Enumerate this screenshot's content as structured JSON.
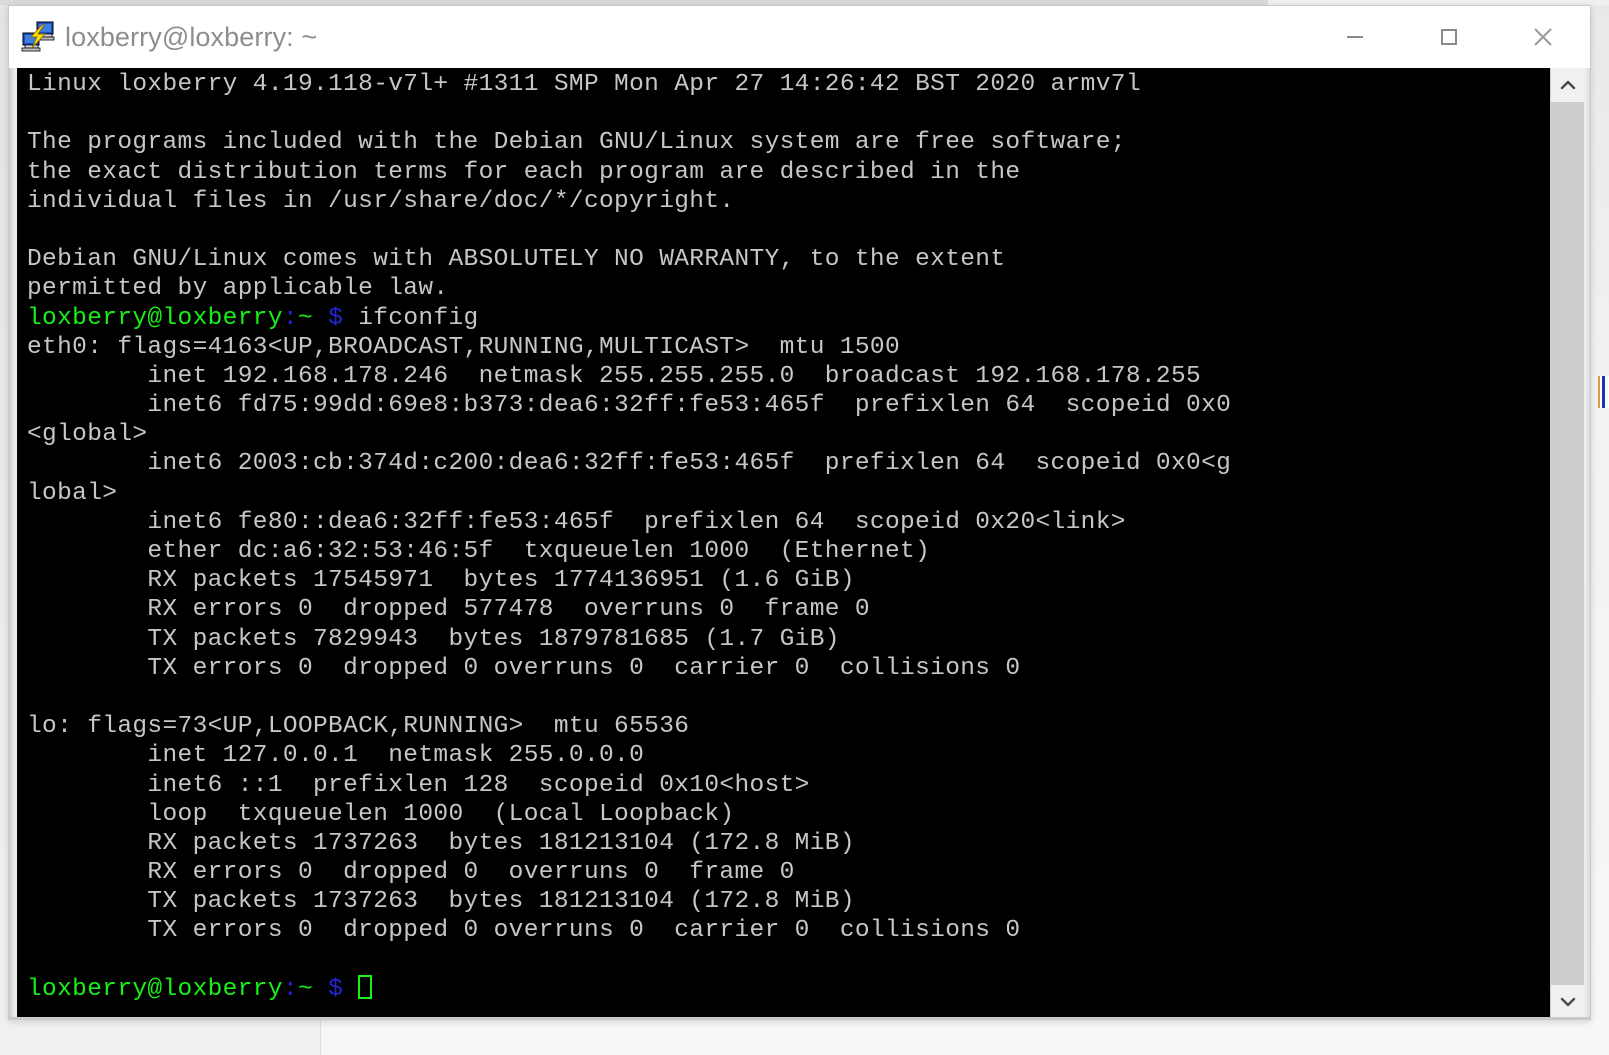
{
  "window": {
    "title": "loxberry@loxberry: ~",
    "icon": "putty-computers-icon",
    "controls": {
      "minimize": "—",
      "maximize": "□",
      "close": "✕"
    }
  },
  "scrollbar": {
    "up_arrow": "∧",
    "down_arrow": "∨"
  },
  "terminal": {
    "colors": {
      "background": "#000000",
      "foreground": "#bfbfbf",
      "prompt_user": "#18f018",
      "prompt_symbol": "#2424d6",
      "cursor": "#18f018"
    },
    "prompt": {
      "user_host": "loxberry@loxberry",
      "separator": ":",
      "path": "~",
      "dollar": "$"
    },
    "command": "ifconfig",
    "lines": [
      "Linux loxberry 4.19.118-v7l+ #1311 SMP Mon Apr 27 14:26:42 BST 2020 armv7l",
      "",
      "The programs included with the Debian GNU/Linux system are free software;",
      "the exact distribution terms for each program are described in the",
      "individual files in /usr/share/doc/*/copyright.",
      "",
      "Debian GNU/Linux comes with ABSOLUTELY NO WARRANTY, to the extent",
      "permitted by applicable law."
    ],
    "output_lines": [
      "eth0: flags=4163<UP,BROADCAST,RUNNING,MULTICAST>  mtu 1500",
      "        inet 192.168.178.246  netmask 255.255.255.0  broadcast 192.168.178.255",
      "        inet6 fd75:99dd:69e8:b373:dea6:32ff:fe53:465f  prefixlen 64  scopeid 0x0",
      "<global>",
      "        inet6 2003:cb:374d:c200:dea6:32ff:fe53:465f  prefixlen 64  scopeid 0x0<g",
      "lobal>",
      "        inet6 fe80::dea6:32ff:fe53:465f  prefixlen 64  scopeid 0x20<link>",
      "        ether dc:a6:32:53:46:5f  txqueuelen 1000  (Ethernet)",
      "        RX packets 17545971  bytes 1774136951 (1.6 GiB)",
      "        RX errors 0  dropped 577478  overruns 0  frame 0",
      "        TX packets 7829943  bytes 1879781685 (1.7 GiB)",
      "        TX errors 0  dropped 0 overruns 0  carrier 0  collisions 0",
      "",
      "lo: flags=73<UP,LOOPBACK,RUNNING>  mtu 65536",
      "        inet 127.0.0.1  netmask 255.0.0.0",
      "        inet6 ::1  prefixlen 128  scopeid 0x10<host>",
      "        loop  txqueuelen 1000  (Local Loopback)",
      "        RX packets 1737263  bytes 181213104 (172.8 MiB)",
      "        RX errors 0  dropped 0  overruns 0  frame 0",
      "        TX packets 1737263  bytes 181213104 (172.8 MiB)",
      "        TX errors 0  dropped 0 overruns 0  carrier 0  collisions 0",
      ""
    ]
  }
}
